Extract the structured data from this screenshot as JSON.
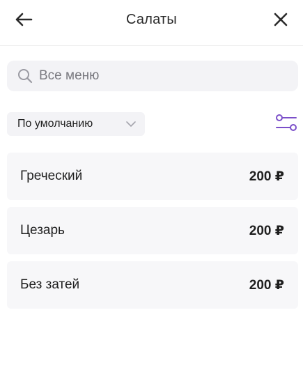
{
  "header": {
    "title": "Салаты",
    "back_icon": "arrow-left-icon",
    "close_icon": "close-icon"
  },
  "search": {
    "placeholder": "Все меню",
    "value": ""
  },
  "sort": {
    "selected": "По умолчанию"
  },
  "filter": {
    "icon": "filter-sliders-icon",
    "accent_color": "#7b4fc9"
  },
  "items": [
    {
      "name": "Греческий",
      "price": "200 ₽"
    },
    {
      "name": "Цезарь",
      "price": "200 ₽"
    },
    {
      "name": "Без затей",
      "price": "200 ₽"
    }
  ]
}
